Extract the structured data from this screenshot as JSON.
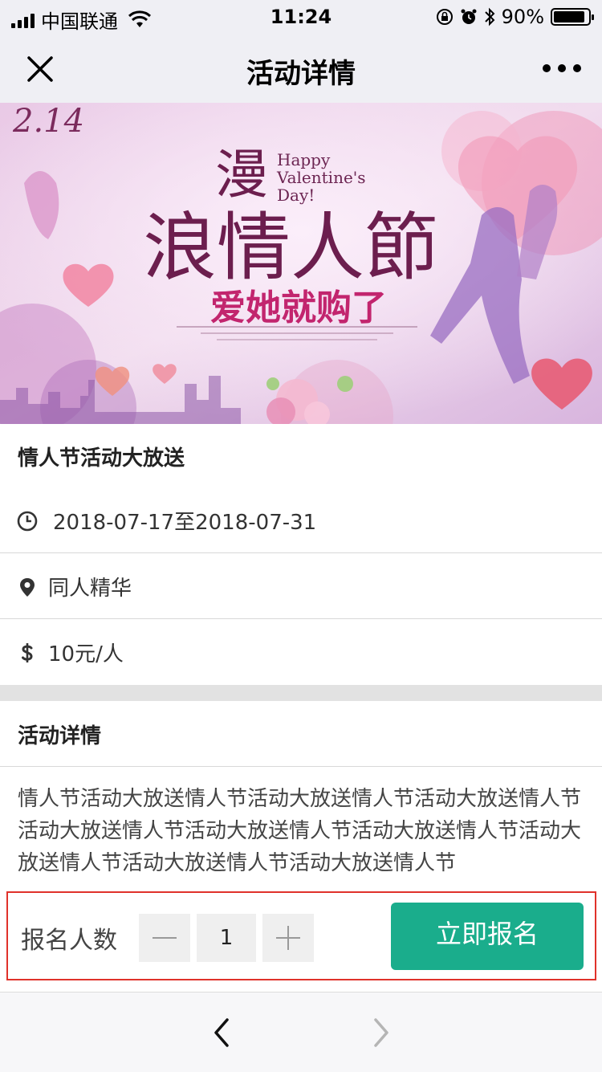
{
  "status_bar": {
    "carrier": "中国联通",
    "time": "11:24",
    "battery_percent": "90%",
    "battery_level": 0.9
  },
  "nav": {
    "title": "活动详情"
  },
  "banner": {
    "date_text": "2.14",
    "english_text_line1": "Happy",
    "english_text_line2": "Valentine's",
    "english_text_line3": "Day!",
    "headline_char1": "漫",
    "headline_line": "浪情人節",
    "subline": "爱她就购了"
  },
  "event": {
    "title": "情人节活动大放送",
    "date_range": "2018-07-17至2018-07-31",
    "location": "同人精华",
    "price": "10元/人"
  },
  "details": {
    "heading": "活动详情",
    "description": "情人节活动大放送情人节活动大放送情人节活动大放送情人节活动大放送情人节活动大放送情人节活动大放送情人节活动大放送情人节活动大放送情人节活动大放送情人节"
  },
  "signup": {
    "label": "报名人数",
    "quantity": "1",
    "button_label": "立即报名"
  },
  "icons": {
    "close": "close-icon",
    "more": "more-icon",
    "clock": "clock-icon",
    "location": "location-pin-icon",
    "price": "dollar-icon",
    "minus": "minus-icon",
    "plus": "plus-icon",
    "back": "chevron-left-icon",
    "forward": "chevron-right-icon"
  },
  "colors": {
    "accent_green": "#1aad8c",
    "highlight_red": "#e0322b",
    "nav_bg": "#efeff4"
  }
}
